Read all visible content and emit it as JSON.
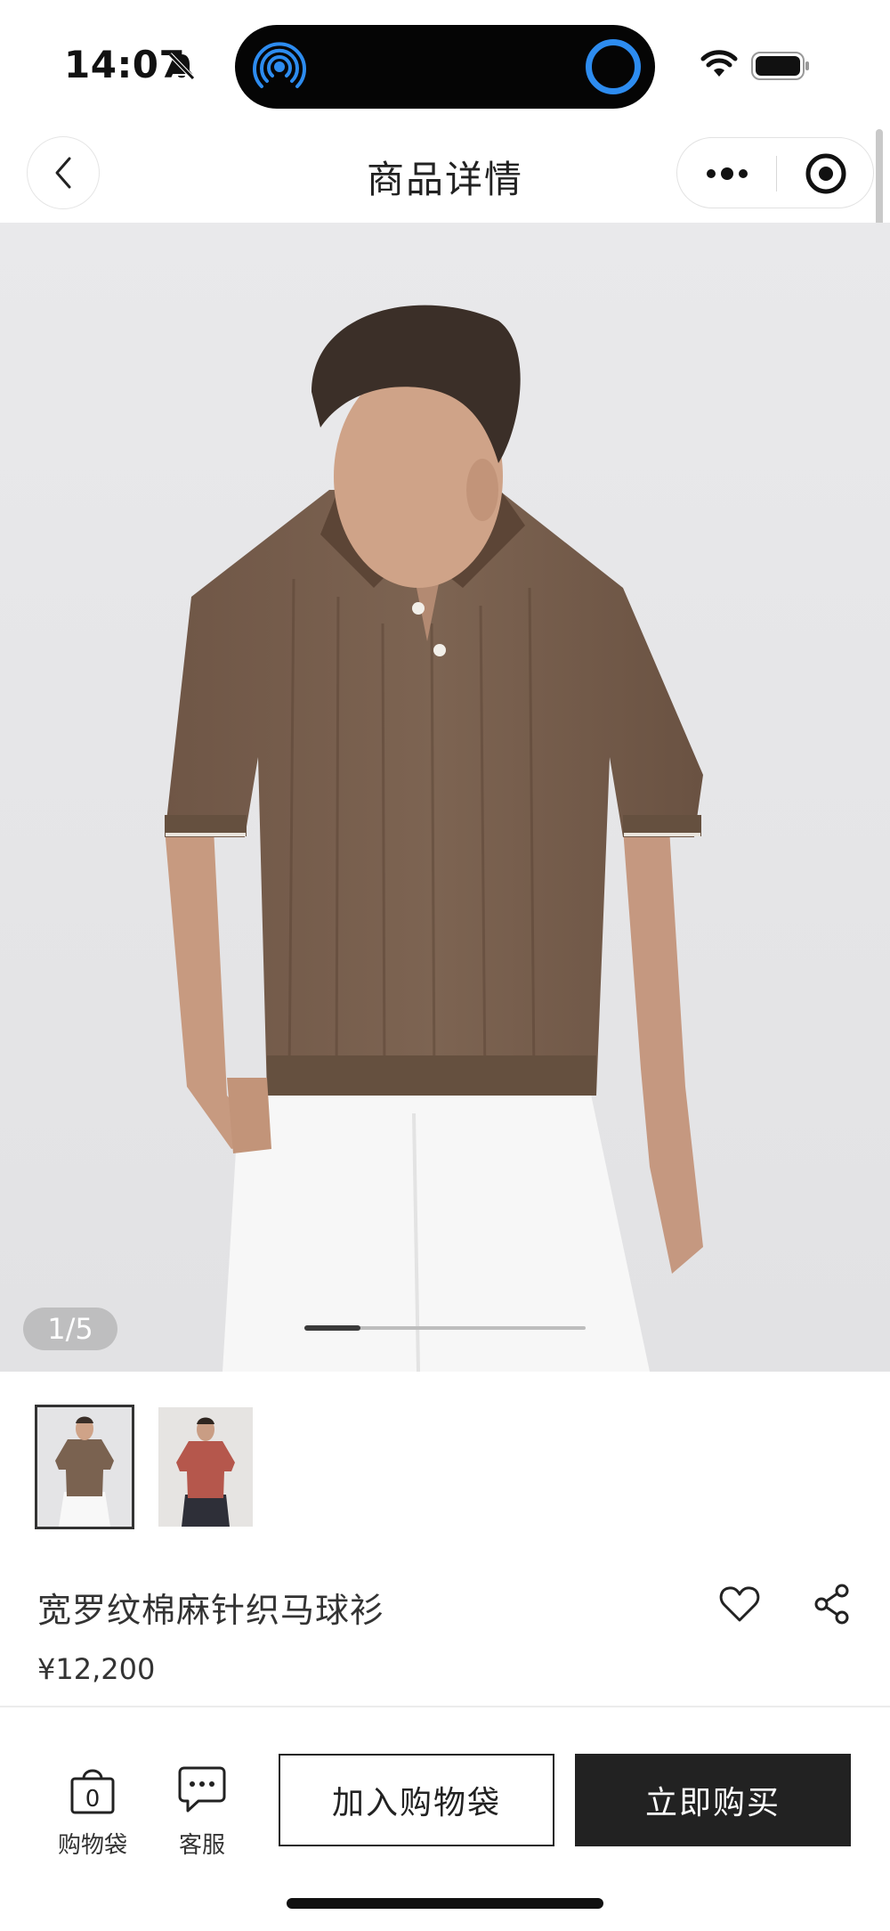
{
  "status_bar": {
    "time": "14:07"
  },
  "nav": {
    "title": "商品详情"
  },
  "gallery": {
    "counter": "1/5",
    "current_index": 1,
    "total": 5,
    "progress_fraction": 0.2,
    "thumbnails": [
      {
        "label": "brown polo thumbnail",
        "active": true
      },
      {
        "label": "red polo thumbnail",
        "active": false
      }
    ]
  },
  "product": {
    "name": "宽罗纹棉麻针织马球衫",
    "price": "¥12,200"
  },
  "bottom_bar": {
    "bag_label": "购物袋",
    "bag_count": "0",
    "service_label": "客服",
    "add_to_bag_label": "加入购物袋",
    "buy_now_label": "立即购买"
  },
  "colors": {
    "accent": "#2d8cf0",
    "primary_button": "#222222",
    "hero_background": "#e6e6e8",
    "shirt_brown": "#7a6250",
    "shirt_red": "#b5574c"
  }
}
